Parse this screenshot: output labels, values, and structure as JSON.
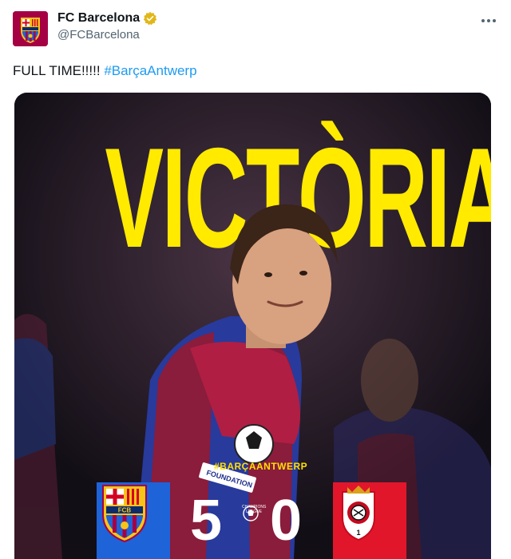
{
  "account": {
    "display_name": "FC Barcelona",
    "handle": "@FCBarcelona"
  },
  "tweet": {
    "text": "FULL TIME!!!!! ",
    "hashtag": "#BarçaAntwerp"
  },
  "media": {
    "headline": "VICTÒRIA",
    "hashtag_overlay": "#BARÇAANTWERP",
    "home_score": "5",
    "away_score": "0",
    "home_crest_text": "FCB",
    "away_crest_number": "1",
    "competition_logo_text": "CHAMPIONS LEAGUE",
    "player_sleeve_text": "FOUNDATION",
    "colors": {
      "headline": "#ffea00",
      "home_box": "#1f63d8",
      "away_box": "#e2162b",
      "hashtag_link": "#1d9bf0"
    }
  },
  "icons": {
    "verified": "verified-badge-icon",
    "more": "more-options-icon"
  }
}
